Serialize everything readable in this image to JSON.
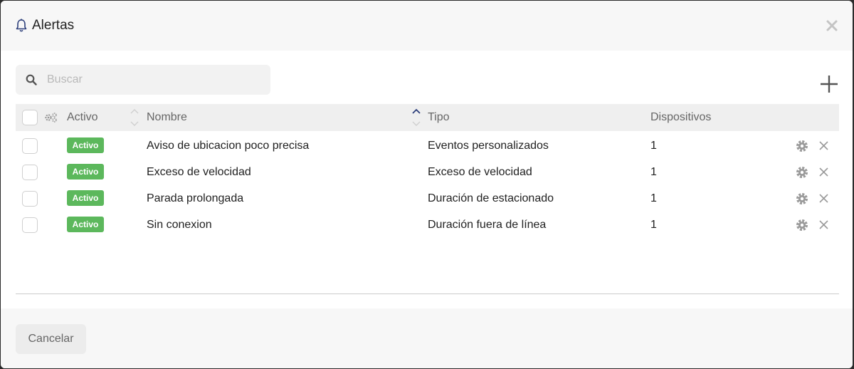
{
  "dialog": {
    "title": "Alertas",
    "icon": "bell-icon",
    "close_icon": "close-icon"
  },
  "search": {
    "placeholder": "Buscar",
    "value": "",
    "icon": "search-icon"
  },
  "toolbar": {
    "add_icon": "plus-icon"
  },
  "table": {
    "columns": {
      "settings_icon": "cogs-icon",
      "active": "Activo",
      "name": "Nombre",
      "type": "Tipo",
      "devices": "Dispositivos"
    },
    "sorted_column": "Nombre",
    "sort_direction": "ascending",
    "rows": [
      {
        "status": "Activo",
        "name": "Aviso de ubicacion poco precisa",
        "type": "Eventos personalizados",
        "devices": "1"
      },
      {
        "status": "Activo",
        "name": "Exceso de velocidad",
        "type": "Exceso de velocidad",
        "devices": "1"
      },
      {
        "status": "Activo",
        "name": "Parada prolongada",
        "type": "Duración de estacionado",
        "devices": "1"
      },
      {
        "status": "Activo",
        "name": "Sin conexion",
        "type": "Duración fuera de línea",
        "devices": "1"
      }
    ]
  },
  "footer": {
    "cancel_label": "Cancelar"
  },
  "colors": {
    "badge_active": "#5cb85c",
    "sort_active": "#2c3e7a",
    "header_bg": "#efefef"
  }
}
